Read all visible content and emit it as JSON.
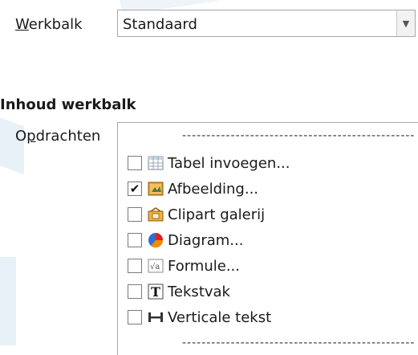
{
  "toolbar_selector": {
    "label_prefix": "W",
    "label_rest": "erkbalk",
    "selected_value": "Standaard"
  },
  "section": {
    "title": "Inhoud werkbalk"
  },
  "commands": {
    "label_prefix": "O",
    "label_underlined": "p",
    "label_rest": "drachten",
    "separator": "------------------------------------------------",
    "items": [
      {
        "label": "Tabel invoegen...",
        "checked": false,
        "icon": "table-icon"
      },
      {
        "label": "Afbeelding...",
        "checked": true,
        "icon": "image-icon"
      },
      {
        "label": "Clipart galerij",
        "checked": false,
        "icon": "gallery-icon"
      },
      {
        "label": "Diagram...",
        "checked": false,
        "icon": "chart-icon"
      },
      {
        "label": "Formule...",
        "checked": false,
        "icon": "formula-icon"
      },
      {
        "label": "Tekstvak",
        "checked": false,
        "icon": "textbox-icon"
      },
      {
        "label": "Verticale tekst",
        "checked": false,
        "icon": "vertical-text-icon"
      }
    ],
    "check_mark": "✔"
  }
}
